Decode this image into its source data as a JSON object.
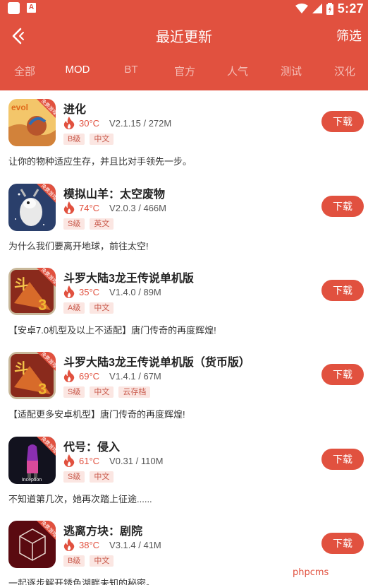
{
  "status_bar": {
    "time": "5:27",
    "notification_badge": "A"
  },
  "header": {
    "title": "最近更新",
    "filter_label": "筛选"
  },
  "tabs": [
    {
      "label": "全部",
      "active": false
    },
    {
      "label": "MOD",
      "active": true
    },
    {
      "label": "BT",
      "active": false
    },
    {
      "label": "官方",
      "active": false
    },
    {
      "label": "人气",
      "active": false
    },
    {
      "label": "测试",
      "active": false
    },
    {
      "label": "汉化",
      "active": false
    }
  ],
  "download_label": "下载",
  "items": [
    {
      "name": "进化",
      "temp": "30°C",
      "version": "V2.1.15 / 272M",
      "tags": [
        "B级",
        "中文"
      ],
      "desc": "让你的物种适应生存，并且比对手领先一步。",
      "icon": "evolution-game-icon"
    },
    {
      "name": "模拟山羊：太空废物",
      "temp": "74°C",
      "version": "V2.0.3 / 466M",
      "tags": [
        "S级",
        "英文"
      ],
      "desc": "为什么我们要离开地球，前往太空!",
      "icon": "goat-space-game-icon"
    },
    {
      "name": "斗罗大陆3龙王传说单机版",
      "temp": "35°C",
      "version": "V1.4.0 / 89M",
      "tags": [
        "A级",
        "中文"
      ],
      "desc": "【安卓7.0机型及以上不适配】唐门传奇的再度辉煌!",
      "icon": "douluo-game-icon"
    },
    {
      "name": "斗罗大陆3龙王传说单机版（货币版）",
      "temp": "69°C",
      "version": "V1.4.1 / 67M",
      "tags": [
        "S级",
        "中文",
        "云存档"
      ],
      "desc": "【适配更多安卓机型】唐门传奇的再度辉煌!",
      "icon": "douluo-game-icon"
    },
    {
      "name": "代号：侵入",
      "temp": "61°C",
      "version": "V0.31 / 110M",
      "tags": [
        "S级",
        "中文"
      ],
      "desc": "不知道第几次，她再次踏上征途......",
      "icon": "inception-game-icon",
      "icon_text": "Inception"
    },
    {
      "name": "逃离方块：剧院",
      "temp": "38°C",
      "version": "V3.1.4 / 41M",
      "tags": [
        "B级",
        "中文"
      ],
      "desc": "一起逐步解开锈色湖畔未知的秘密。",
      "icon": "rusty-lake-cube-game-icon"
    }
  ],
  "icon_badge": "免费游戏",
  "watermark": "phpcms",
  "colors": {
    "primary": "#e1513f",
    "tag_bg": "#fbe6e2",
    "tag_text": "#c8594b"
  }
}
